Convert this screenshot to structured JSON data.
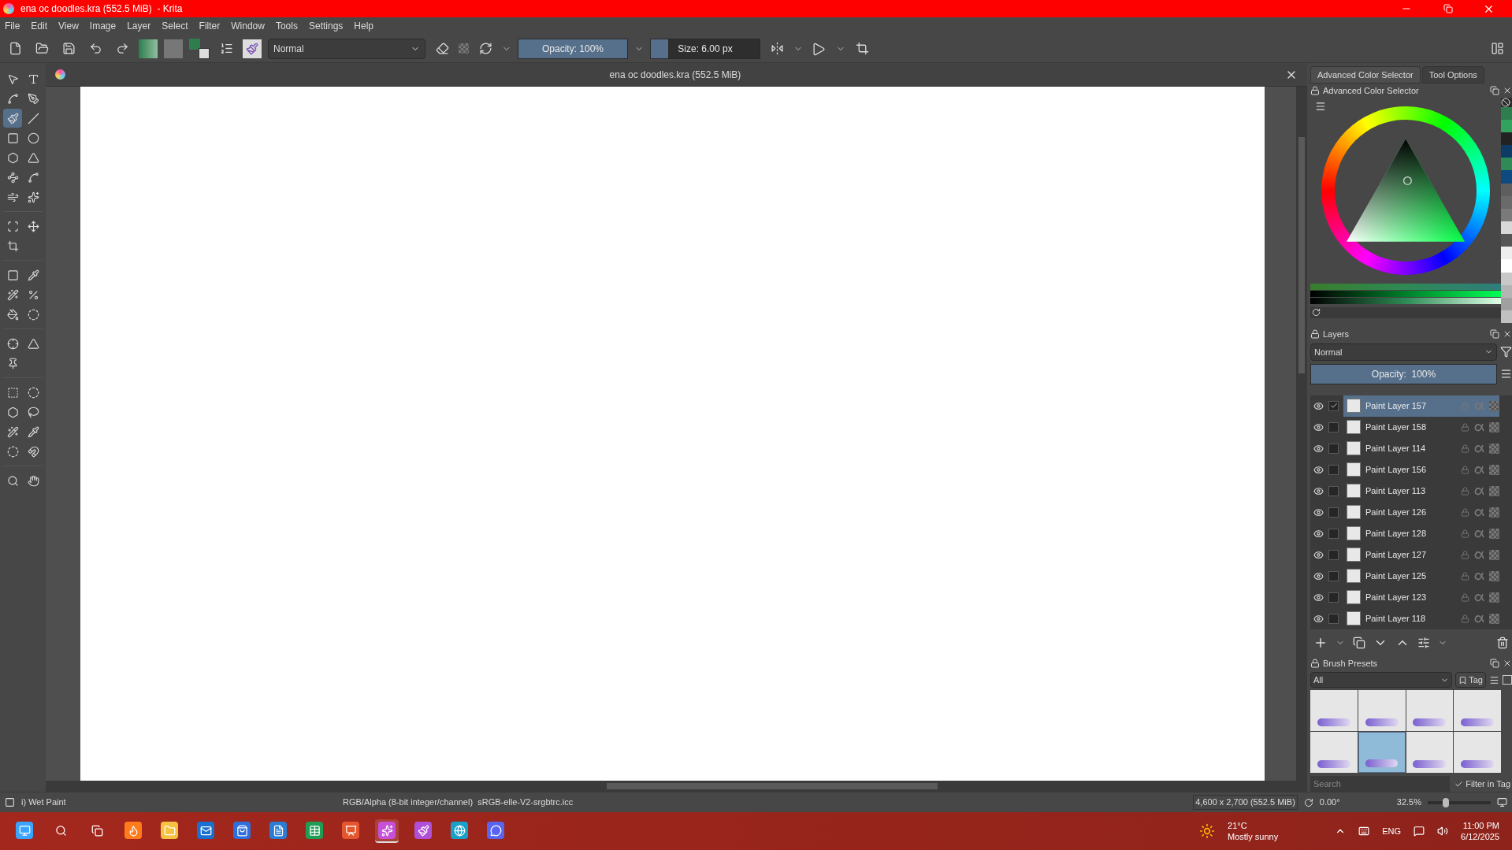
{
  "window": {
    "title": "ena oc doodles.kra (552.5 MiB)  - Krita"
  },
  "menu": [
    "File",
    "Edit",
    "View",
    "Image",
    "Layer",
    "Select",
    "Filter",
    "Window",
    "Tools",
    "Settings",
    "Help"
  ],
  "toolbar": {
    "blend_mode": "Normal",
    "opacity": {
      "label": "Opacity: 100%",
      "level": 1
    },
    "size": {
      "label": "Size: 6.00 px",
      "level": 0.16
    }
  },
  "toolbox": [
    [
      {
        "selected": false
      },
      {
        "selected": false
      },
      {
        "selected": false
      },
      {
        "selected": false
      },
      {
        "selected": true
      },
      {
        "selected": false
      },
      {
        "selected": false
      },
      {
        "selected": false
      },
      {
        "selected": false
      },
      {
        "selected": false
      },
      {
        "selected": false
      },
      {
        "selected": false
      },
      {
        "selected": false
      },
      {
        "selected": false
      }
    ],
    [
      {
        "selected": false
      },
      {
        "selected": false
      },
      {
        "selected": false
      }
    ],
    [
      {
        "selected": false
      },
      {
        "selected": false
      },
      {
        "selected": false
      },
      {
        "selected": false
      },
      {
        "selected": false
      },
      {
        "selected": false
      }
    ],
    [
      {
        "selected": false
      },
      {
        "selected": false
      },
      {
        "selected": false
      }
    ],
    [
      {
        "selected": false
      },
      {
        "selected": false
      },
      {
        "selected": false
      },
      {
        "selected": false
      },
      {
        "selected": false
      },
      {
        "selected": false
      },
      {
        "selected": false
      },
      {
        "selected": false
      }
    ],
    [
      {
        "selected": false
      },
      {
        "selected": false
      }
    ]
  ],
  "document": {
    "title": "ena oc doodles.kra (552.5 MiB)"
  },
  "docker_tabs": [
    {
      "label": "Advanced Color Selector",
      "selected": true
    },
    {
      "label": "Tool Options",
      "selected": false
    }
  ],
  "color_selector": {
    "title": "Advanced Color Selector",
    "recent_colors": [
      {
        "color": "#2e7d4f"
      },
      {
        "color": "#31a35e"
      },
      {
        "color": "#222222"
      },
      {
        "color": "#0d3b66"
      },
      {
        "color": "#2f8a55"
      },
      {
        "color": "#0e4a80"
      },
      {
        "color": "#5e5e5e"
      },
      {
        "color": "#6a6a6a"
      },
      {
        "color": "#7a7a7a"
      },
      {
        "color": "#d8d8d8"
      },
      {
        "color": "#555555"
      },
      {
        "color": "#eeeeee"
      },
      {
        "color": "#ffffff"
      },
      {
        "color": "#c8c8c8"
      },
      {
        "color": "#b4b4b4"
      },
      {
        "color": "#a0a0a0"
      },
      {
        "color": "#c0c0c0"
      }
    ]
  },
  "layers": {
    "title": "Layers",
    "blend_mode": "Normal",
    "opacity": {
      "label": "Opacity:  100%",
      "level": 1
    },
    "items": [
      {
        "name": "Paint Layer 157",
        "selected": true,
        "checked": true,
        "visible": true
      },
      {
        "name": "Paint Layer 158",
        "selected": false,
        "checked": false,
        "visible": true
      },
      {
        "name": "Paint Layer 114",
        "selected": false,
        "checked": false,
        "visible": true
      },
      {
        "name": "Paint Layer 156",
        "selected": false,
        "checked": false,
        "visible": true
      },
      {
        "name": "Paint Layer 113",
        "selected": false,
        "checked": false,
        "visible": true
      },
      {
        "name": "Paint Layer 126",
        "selected": false,
        "checked": false,
        "visible": true
      },
      {
        "name": "Paint Layer 128",
        "selected": false,
        "checked": false,
        "visible": true
      },
      {
        "name": "Paint Layer 127",
        "selected": false,
        "checked": false,
        "visible": true
      },
      {
        "name": "Paint Layer 125",
        "selected": false,
        "checked": false,
        "visible": true
      },
      {
        "name": "Paint Layer 123",
        "selected": false,
        "checked": false,
        "visible": true
      },
      {
        "name": "Paint Layer 118",
        "selected": false,
        "checked": false,
        "visible": true
      }
    ]
  },
  "brush_presets": {
    "title": "Brush Presets",
    "tag_filter": "All",
    "tag_button": "Tag",
    "presets": [
      {
        "selected": false
      },
      {
        "selected": false
      },
      {
        "selected": false
      },
      {
        "selected": false
      },
      {
        "selected": false
      },
      {
        "selected": true
      },
      {
        "selected": false
      },
      {
        "selected": false
      }
    ],
    "search": {
      "placeholder": "Search"
    },
    "filter_in_tag": {
      "label": "Filter in Tag",
      "checked": true
    }
  },
  "status_bar": {
    "brush": "i) Wet Paint",
    "color_space": "RGB/Alpha (8-bit integer/channel)  sRGB-elle-V2-srgbtrc.icc",
    "image_size": "4,600 x 2,700 (552.5 MiB)",
    "rotation": "0.00°",
    "zoom": "32.5%",
    "zoom_slider": {
      "level": 0.27
    }
  },
  "taskbar": {
    "apps": [
      {
        "selected": false
      },
      {
        "selected": false
      },
      {
        "selected": false
      },
      {
        "selected": false
      },
      {
        "selected": false
      },
      {
        "selected": false
      },
      {
        "selected": false
      },
      {
        "selected": false
      },
      {
        "selected": false
      },
      {
        "selected": false
      },
      {
        "selected": true
      },
      {
        "selected": false
      },
      {
        "selected": false
      },
      {
        "selected": false
      }
    ],
    "weather": {
      "temperature": "21°C",
      "condition": "Mostly sunny"
    },
    "language": "ENG",
    "time": "11:00 PM",
    "date": "6/12/2025"
  }
}
